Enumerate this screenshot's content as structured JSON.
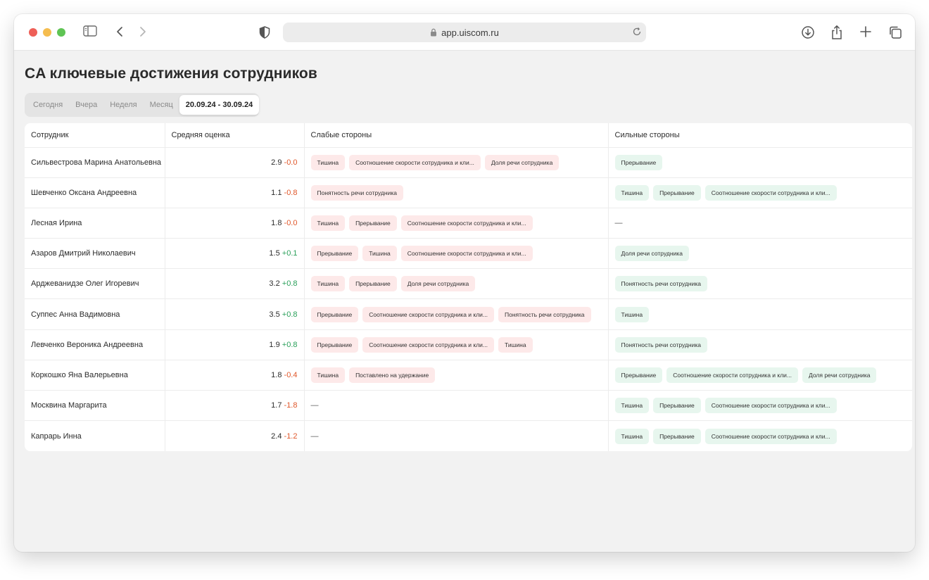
{
  "browser": {
    "url": "app.uiscom.ru",
    "icons": {
      "sidebar": "sidebar-icon",
      "back": "chevron-left-icon",
      "forward": "chevron-right-icon",
      "shield": "shield-icon",
      "lock": "lock-icon",
      "reload": "reload-icon",
      "download": "download-icon",
      "share": "share-icon",
      "new_tab": "plus-icon",
      "tabs": "tabs-icon"
    }
  },
  "page": {
    "title": "CA ключевые достижения сотрудников"
  },
  "periods": {
    "items": [
      "Сегодня",
      "Вчера",
      "Неделя",
      "Месяц",
      "20.09.24 - 30.09.24"
    ],
    "selected": "20.09.24 - 30.09.24"
  },
  "colors": {
    "negative_delta": "#e0572a",
    "positive_delta": "#2aa05a",
    "weak_tag_bg": "#fde9e9",
    "strong_tag_bg": "#e7f6ee"
  },
  "table": {
    "headers": {
      "employee": "Сотрудник",
      "avg_score": "Средняя оценка",
      "weak": "Слабые стороны",
      "strong": "Сильные стороны"
    },
    "rows": [
      {
        "employee": "Сильвестрова Марина Анатольевна",
        "score": "2.9",
        "delta": "-0.0",
        "trend": "neg",
        "weak": [
          "Тишина",
          "Соотношение скорости сотрудника и кли...",
          "Доля речи сотрудника"
        ],
        "strong": [
          "Прерывание"
        ]
      },
      {
        "employee": "Шевченко Оксана Андреевна",
        "score": "1.1",
        "delta": "-0.8",
        "trend": "neg",
        "weak": [
          "Понятность речи сотрудника"
        ],
        "strong": [
          "Тишина",
          "Прерывание",
          "Соотношение скорости сотрудника и кли..."
        ]
      },
      {
        "employee": "Лесная Ирина",
        "score": "1.8",
        "delta": "-0.0",
        "trend": "neg",
        "weak": [
          "Тишина",
          "Прерывание",
          "Соотношение скорости сотрудника и кли..."
        ],
        "strong": []
      },
      {
        "employee": "Азаров Дмитрий Николаевич",
        "score": "1.5",
        "delta": "+0.1",
        "trend": "pos",
        "weak": [
          "Прерывание",
          "Тишина",
          "Соотношение скорости сотрудника и кли..."
        ],
        "strong": [
          "Доля речи сотрудника"
        ]
      },
      {
        "employee": "Арджеванидзе Олег Игоревич",
        "score": "3.2",
        "delta": "+0.8",
        "trend": "pos",
        "weak": [
          "Тишина",
          "Прерывание",
          "Доля речи сотрудника"
        ],
        "strong": [
          "Понятность речи сотрудника"
        ]
      },
      {
        "employee": "Суппес Анна Вадимовна",
        "score": "3.5",
        "delta": "+0.8",
        "trend": "pos",
        "weak": [
          "Прерывание",
          "Соотношение скорости сотрудника и кли...",
          "Понятность речи сотрудника"
        ],
        "strong": [
          "Тишина"
        ]
      },
      {
        "employee": "Левченко Вероника Андреевна",
        "score": "1.9",
        "delta": "+0.8",
        "trend": "pos",
        "weak": [
          "Прерывание",
          "Соотношение скорости сотрудника и кли...",
          "Тишина"
        ],
        "strong": [
          "Понятность речи сотрудника"
        ]
      },
      {
        "employee": "Коркошко Яна Валерьевна",
        "score": "1.8",
        "delta": "-0.4",
        "trend": "neg",
        "weak": [
          "Тишина",
          "Поставлено на удержание"
        ],
        "strong": [
          "Прерывание",
          "Соотношение скорости сотрудника и кли...",
          "Доля речи сотрудника"
        ]
      },
      {
        "employee": "Москвина Маргарита",
        "score": "1.7",
        "delta": "-1.8",
        "trend": "neg",
        "weak": [],
        "strong": [
          "Тишина",
          "Прерывание",
          "Соотношение скорости сотрудника и кли..."
        ]
      },
      {
        "employee": "Капрарь Инна",
        "score": "2.4",
        "delta": "-1.2",
        "trend": "neg",
        "weak": [],
        "strong": [
          "Тишина",
          "Прерывание",
          "Соотношение скорости сотрудника и кли..."
        ]
      }
    ],
    "empty_value": "—"
  }
}
